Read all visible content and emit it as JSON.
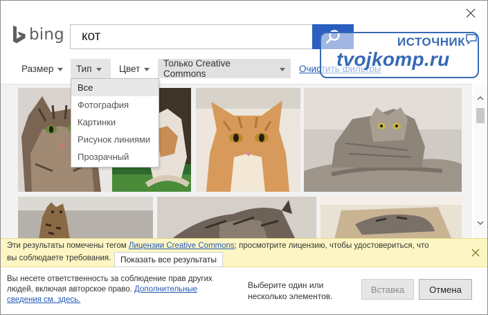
{
  "header": {
    "logo_text": "bing",
    "search_value": "кот"
  },
  "watermark": {
    "label": "ИСТОЧНИК",
    "site": "tvojkomp.ru"
  },
  "filters": {
    "size": "Размер",
    "type": "Тип",
    "color": "Цвет",
    "license": "Только Creative Commons",
    "clear": "Очистить фильтры"
  },
  "type_dropdown": {
    "options": [
      "Все",
      "Фотография",
      "Картинки",
      "Рисунок линиями",
      "Прозрачный"
    ],
    "selected": "Все"
  },
  "notice": {
    "prefix": "Эти результаты помечены тегом ",
    "license_link": "Лицензии Creative Commons",
    "suffix": "; просмотрите лицензию, чтобы удостовериться, что",
    "line2": "вы соблюдаете требования.",
    "show_all": "Показать все результаты"
  },
  "footer": {
    "responsibility": "Вы несете ответственность за соблюдение прав других людей, включая авторское право. ",
    "more_link": "Дополнительные сведения см. здесь.",
    "select_hint": "Выберите один или несколько элементов.",
    "insert": "Вставка",
    "cancel": "Отмена"
  },
  "colors": {
    "accent": "#2b5fbf",
    "link": "#2459b5",
    "notice_bg": "#fdf6c4",
    "watermark": "#3569b4"
  }
}
